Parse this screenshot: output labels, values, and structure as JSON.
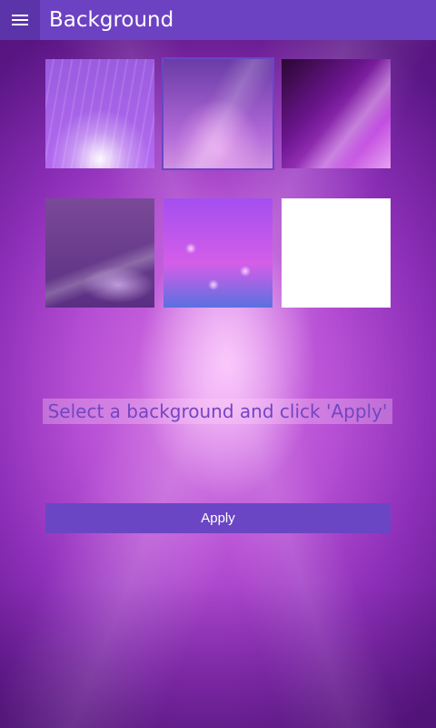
{
  "header": {
    "title": "Background",
    "menu_icon": "hamburger-menu-icon"
  },
  "backgrounds": [
    {
      "id": "purple-light-rays",
      "selected": false
    },
    {
      "id": "purple-abstract-rays",
      "selected": true
    },
    {
      "id": "dark-purple-gradient",
      "selected": false
    },
    {
      "id": "purple-swirl",
      "selected": false
    },
    {
      "id": "purple-bokeh",
      "selected": false
    },
    {
      "id": "plain-white",
      "selected": false
    }
  ],
  "instruction_text": "Select a background and click 'Apply'",
  "apply_label": "Apply",
  "colors": {
    "accent": "#6b46c4",
    "title_bar": "#6c42c2",
    "instruction_text": "#7246c2"
  }
}
